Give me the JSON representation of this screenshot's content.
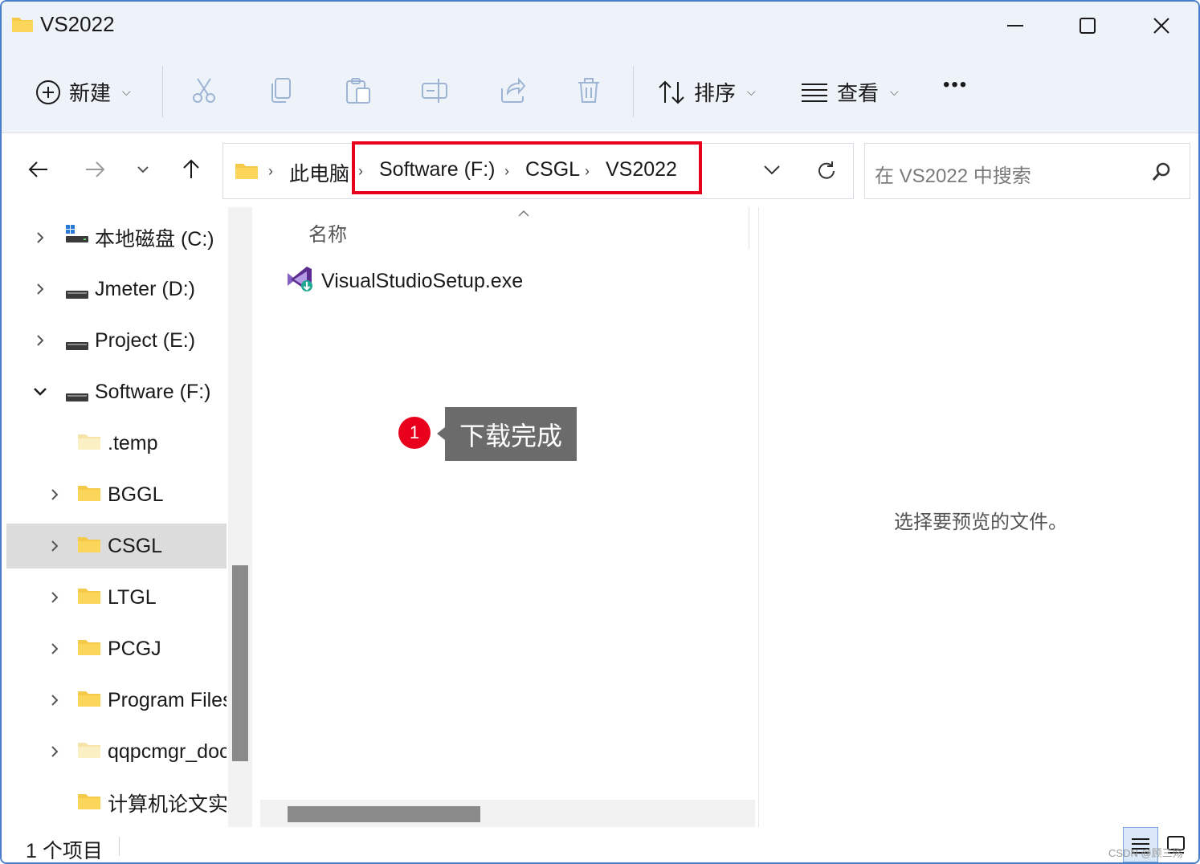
{
  "window": {
    "title": "VS2022"
  },
  "toolbar": {
    "new_label": "新建",
    "sort_label": "排序",
    "view_label": "查看",
    "more_label": "•••"
  },
  "address": {
    "crumbs": [
      "此电脑",
      "Software (F:)",
      "CSGL",
      "VS2022"
    ]
  },
  "search": {
    "placeholder": "在 VS2022 中搜索"
  },
  "sidebar": {
    "items": [
      {
        "label": "本地磁盘 (C:)",
        "icon": "windows-drive-icon",
        "expanded": false
      },
      {
        "label": "Jmeter (D:)",
        "icon": "drive-icon",
        "expanded": false
      },
      {
        "label": "Project (E:)",
        "icon": "drive-icon",
        "expanded": false
      },
      {
        "label": "Software (F:)",
        "icon": "drive-icon",
        "expanded": true
      },
      {
        "label": ".temp",
        "icon": "light-folder-icon",
        "expanded": null
      },
      {
        "label": "BGGL",
        "icon": "folder-icon",
        "expanded": false
      },
      {
        "label": "CSGL",
        "icon": "folder-icon",
        "expanded": false,
        "selected": true
      },
      {
        "label": "LTGL",
        "icon": "folder-icon",
        "expanded": false
      },
      {
        "label": "PCGJ",
        "icon": "folder-icon",
        "expanded": false
      },
      {
        "label": "Program Files",
        "icon": "folder-icon",
        "expanded": false
      },
      {
        "label": "qqpcmgr_doc",
        "icon": "light-folder-icon",
        "expanded": false
      },
      {
        "label": "计算机论文实践",
        "icon": "folder-icon",
        "expanded": null
      }
    ]
  },
  "filelist": {
    "column_name": "名称",
    "files": [
      {
        "name": "VisualStudioSetup.exe",
        "icon": "visual-studio-installer-icon"
      }
    ]
  },
  "annotation": {
    "number": "1",
    "text": "下载完成"
  },
  "preview": {
    "empty_text": "选择要预览的文件。"
  },
  "status": {
    "item_count": "1 个项目",
    "watermark": "CSDN @顾三殇"
  },
  "colors": {
    "highlight_red": "#e8001c",
    "folder_yellow": "#f7c948",
    "selection_gray": "#dcdcdc"
  }
}
